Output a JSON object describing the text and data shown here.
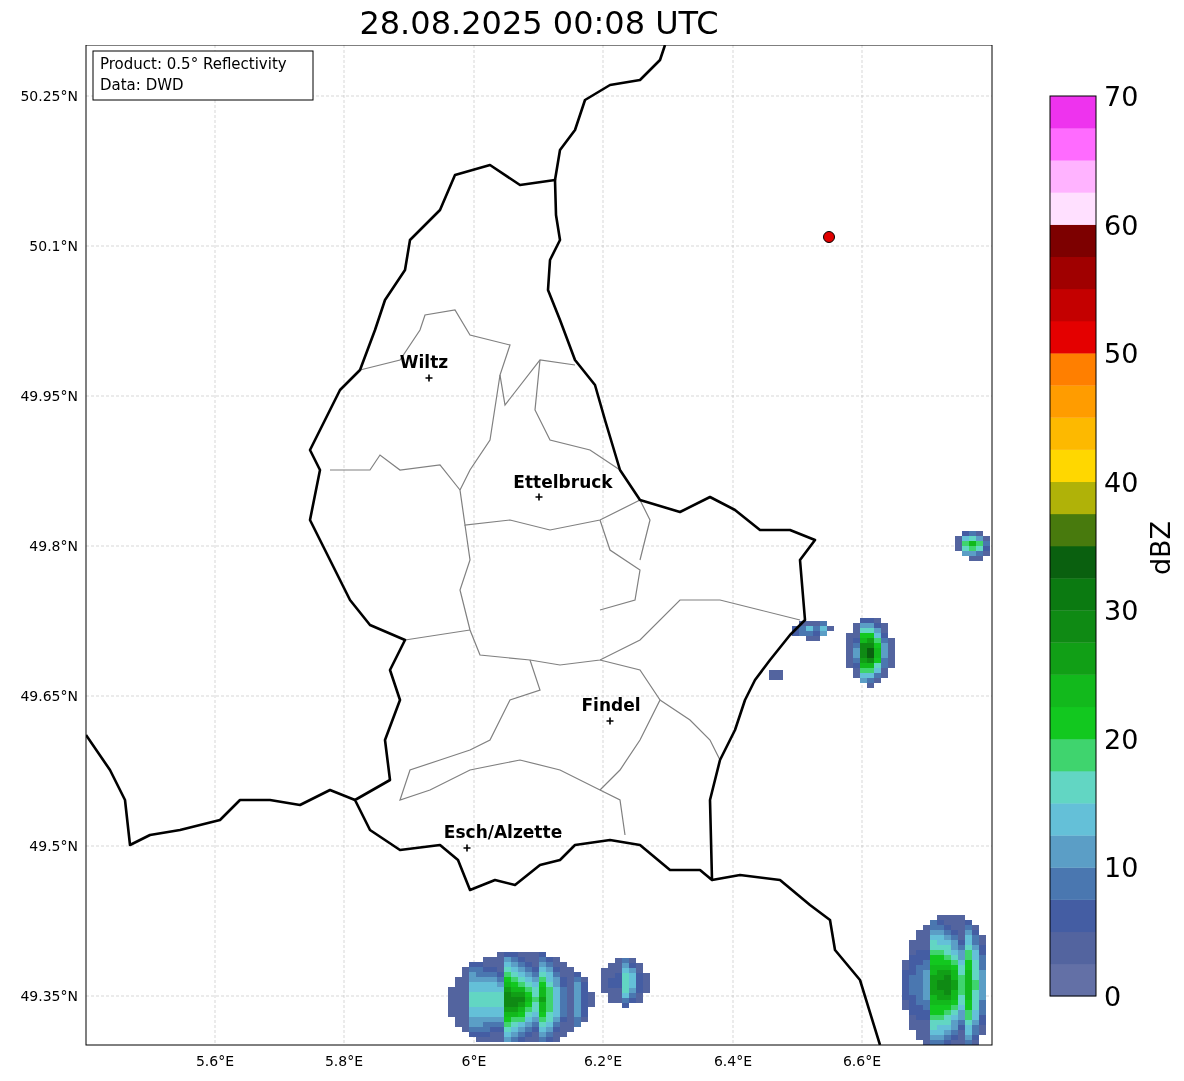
{
  "title": "28.08.2025 00:08 UTC",
  "info_box": {
    "lines": [
      "Product: 0.5° Reflectivity",
      "Data: DWD"
    ]
  },
  "map": {
    "lat_ticks": [
      "50.25°N",
      "50.1°N",
      "49.95°N",
      "49.8°N",
      "49.65°N",
      "49.5°N",
      "49.35°N"
    ],
    "lon_ticks": [
      "5.6°E",
      "5.8°E",
      "6°E",
      "6.2°E",
      "6.4°E",
      "6.6°E"
    ],
    "cities": [
      {
        "name": "Wiltz"
      },
      {
        "name": "Ettelbruck"
      },
      {
        "name": "Findel"
      },
      {
        "name": "Esch/Alzette"
      }
    ]
  },
  "colorbar": {
    "label": "dBZ",
    "ticks": [
      "70",
      "60",
      "50",
      "40",
      "30",
      "20",
      "10",
      "0"
    ]
  }
}
